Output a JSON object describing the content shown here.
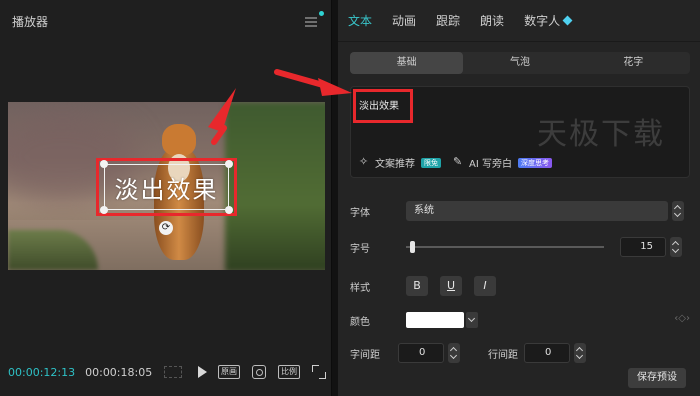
{
  "player": {
    "title": "播放器",
    "overlay_text": "淡出效果",
    "current_time": "00:00:12:13",
    "total_time": "00:00:18:05",
    "buttons": {
      "original": "原画",
      "ratio": "比例"
    }
  },
  "props": {
    "tabs": [
      "文本",
      "动画",
      "跟踪",
      "朗读",
      "数字人"
    ],
    "segments": [
      "基础",
      "气泡",
      "花字"
    ],
    "text_value": "淡出效果",
    "watermark": "天极下载",
    "tools": {
      "recommend": "文案推荐",
      "recommend_badge": "限免",
      "ai_write": "AI 写旁白",
      "ai_badge": "深度思考"
    },
    "font_label": "字体",
    "font_value": "系统",
    "size_label": "字号",
    "size_value": "15",
    "style_label": "样式",
    "style_buttons": [
      "B",
      "U",
      "I"
    ],
    "color_label": "颜色",
    "color_value": "#ffffff",
    "char_spacing_label": "字间距",
    "char_spacing_value": "0",
    "line_spacing_label": "行间距",
    "line_spacing_value": "0",
    "save_preset": "保存预设"
  },
  "colors": {
    "accent": "#39c6cb",
    "highlight": "#e8282c"
  }
}
